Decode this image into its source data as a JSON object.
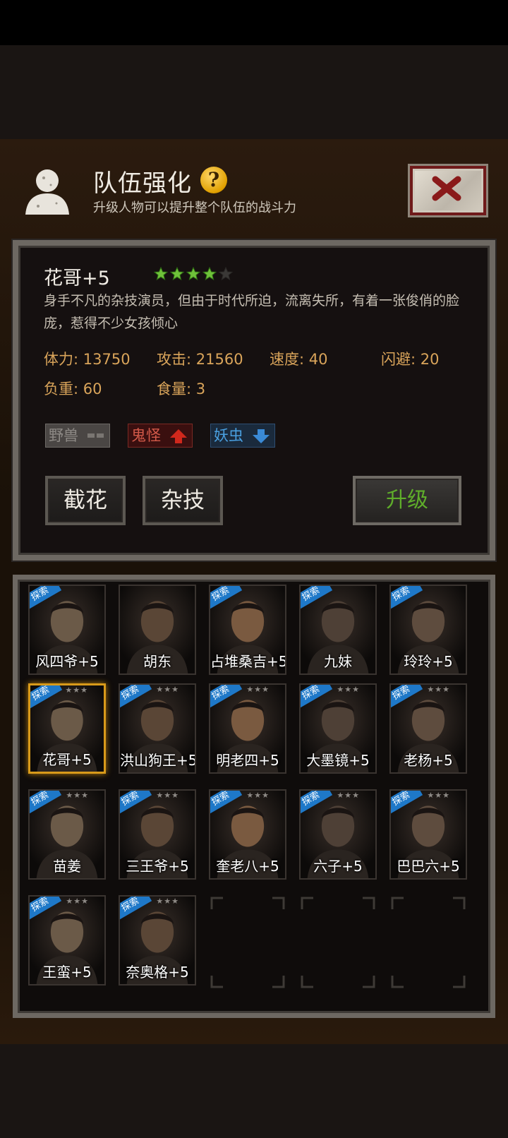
{
  "header": {
    "title": "队伍强化",
    "help_icon": "?",
    "subtitle": "升级人物可以提升整个队伍的战斗力"
  },
  "detail": {
    "name": "花哥+5",
    "rating_filled": 4,
    "rating_total": 5,
    "description": "身手不凡的杂技演员，但由于时代所迫，流离失所，有着一张俊俏的脸庞，惹得不少女孩倾心",
    "stats": {
      "stamina": "体力: 13750",
      "attack": "攻击: 21560",
      "speed": "速度: 40",
      "dodge": "闪避: 20",
      "load": "负重: 60",
      "food": "食量: 3"
    },
    "tags": [
      {
        "label": "野兽",
        "effect": "neutral"
      },
      {
        "label": "鬼怪",
        "effect": "up"
      },
      {
        "label": "妖虫",
        "effect": "down"
      }
    ],
    "skills": [
      "截花",
      "杂技"
    ],
    "upgrade_label": "升级"
  },
  "badge_label": "探索",
  "roster": [
    {
      "name": "风四爷+5",
      "badge": true
    },
    {
      "name": "胡东",
      "badge": false
    },
    {
      "name": "占堆桑吉+5",
      "badge": true
    },
    {
      "name": "九妹",
      "badge": true
    },
    {
      "name": "玲玲+5",
      "badge": true
    },
    {
      "name": "花哥+5",
      "badge": true,
      "selected": true
    },
    {
      "name": "洪山狗王+5",
      "badge": true
    },
    {
      "name": "明老四+5",
      "badge": true
    },
    {
      "name": "大墨镜+5",
      "badge": true
    },
    {
      "name": "老杨+5",
      "badge": true
    },
    {
      "name": "苗姜",
      "badge": true
    },
    {
      "name": "三王爷+5",
      "badge": true
    },
    {
      "name": "奎老八+5",
      "badge": true
    },
    {
      "name": "六子+5",
      "badge": true
    },
    {
      "name": "巴巴六+5",
      "badge": true
    },
    {
      "name": "王蛮+5",
      "badge": true
    },
    {
      "name": "奈奥格+5",
      "badge": true
    }
  ],
  "colors": {
    "stat_text": "#d9a45a",
    "upgrade_text": "#5fae2a",
    "star_green": "#6fc23a",
    "badge_blue": "#1e78c8",
    "selected_border": "#d89a1a"
  }
}
